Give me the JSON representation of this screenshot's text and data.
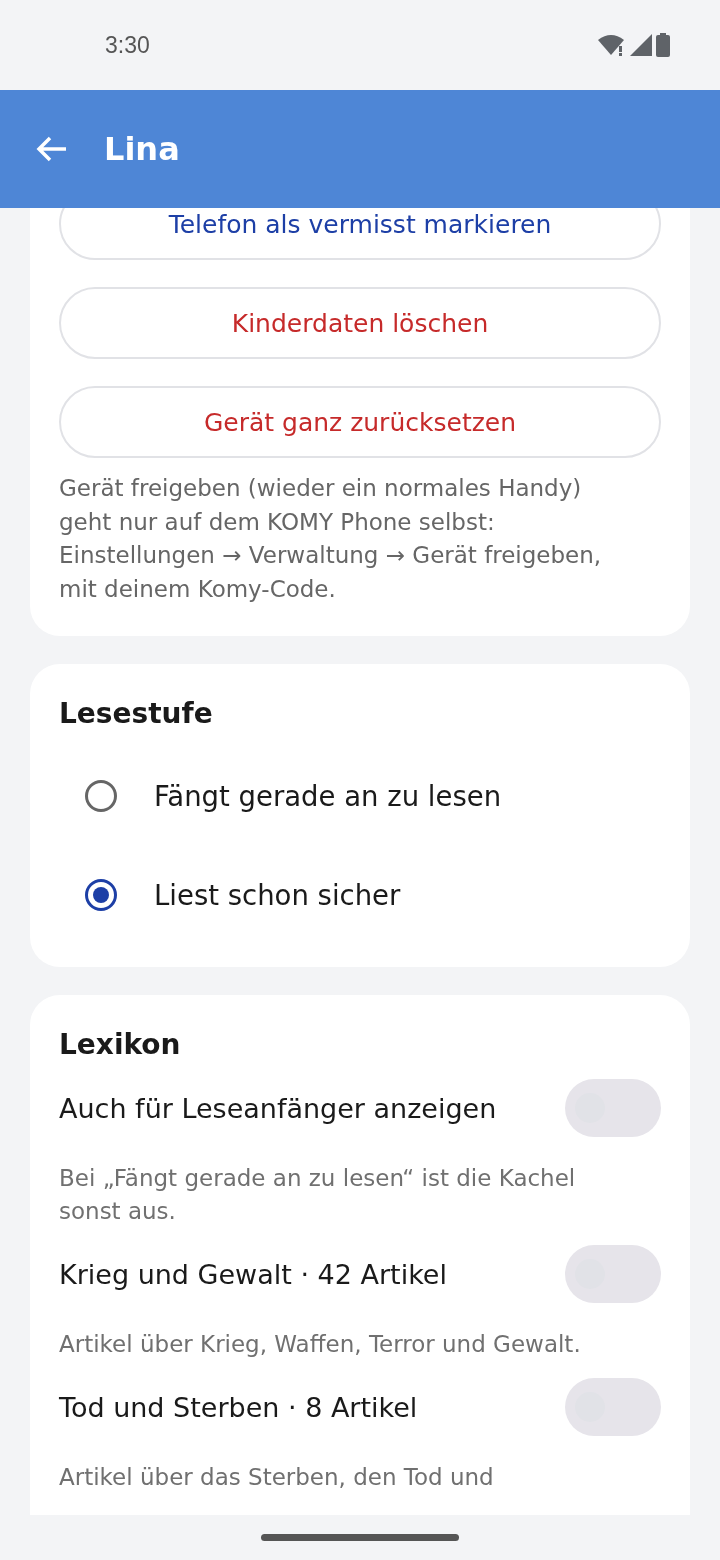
{
  "status_bar": {
    "time": "3:30"
  },
  "app_bar": {
    "title": "Lina"
  },
  "actions": {
    "buttons": [
      {
        "label": "Telefon als vermisst markieren",
        "kind": "primary"
      },
      {
        "label": "Kinderdaten löschen",
        "kind": "danger"
      },
      {
        "label": "Gerät ganz zurücksetzen",
        "kind": "danger"
      }
    ],
    "note": "Gerät freigeben (wieder ein normales Handy) geht nur auf dem KOMY Phone selbst: Einstellungen → Verwaltung → Gerät freigeben, mit deinem Komy-Code."
  },
  "reading_level": {
    "title": "Lesestufe",
    "options": [
      {
        "label": "Fängt gerade an zu lesen",
        "selected": false
      },
      {
        "label": "Liest schon sicher",
        "selected": true
      }
    ]
  },
  "lexicon": {
    "title": "Lexikon",
    "settings": [
      {
        "label": "Auch für Leseanfänger anzeigen",
        "on": false,
        "description": "Bei „Fängt gerade an zu lesen“ ist die Kachel sonst aus."
      },
      {
        "label": "Krieg und Gewalt · 42 Artikel",
        "on": false,
        "description": "Artikel über Krieg, Waffen, Terror und Gewalt."
      },
      {
        "label": "Tod und Sterben · 8 Artikel",
        "on": false,
        "description": "Artikel über das Sterben, den Tod und"
      }
    ]
  }
}
